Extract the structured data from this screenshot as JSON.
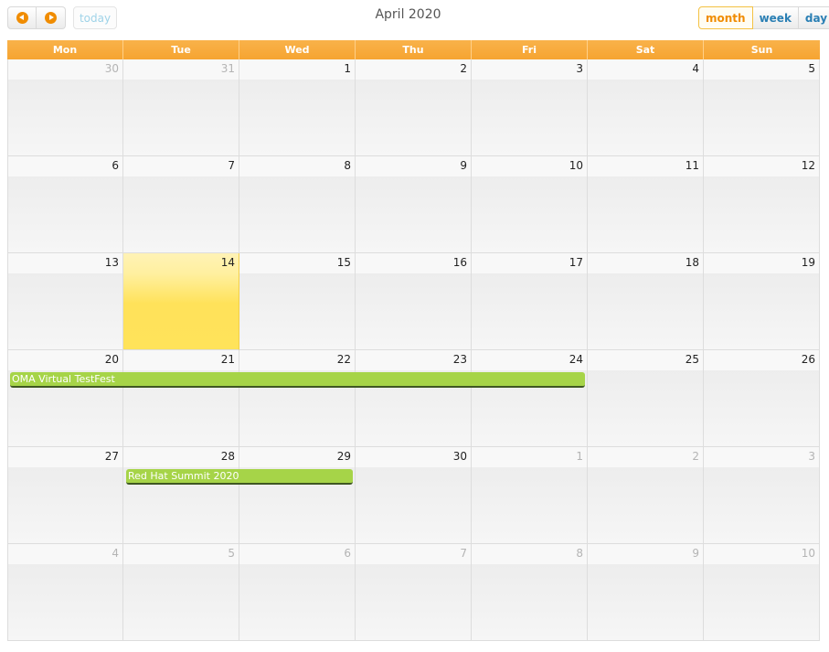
{
  "toolbar": {
    "prev_icon": "chevron-left-circle-icon",
    "next_icon": "chevron-right-circle-icon",
    "today_label": "today",
    "title": "April 2020",
    "views": [
      "month",
      "week",
      "day"
    ],
    "active_view": "month"
  },
  "calendar": {
    "day_headers": [
      "Mon",
      "Tue",
      "Wed",
      "Thu",
      "Fri",
      "Sat",
      "Sun"
    ],
    "weeks": [
      [
        "30",
        "31",
        "1",
        "2",
        "3",
        "4",
        "5"
      ],
      [
        "6",
        "7",
        "8",
        "9",
        "10",
        "11",
        "12"
      ],
      [
        "13",
        "14",
        "15",
        "16",
        "17",
        "18",
        "19"
      ],
      [
        "20",
        "21",
        "22",
        "23",
        "24",
        "25",
        "26"
      ],
      [
        "27",
        "28",
        "29",
        "30",
        "1",
        "2",
        "3"
      ],
      [
        "4",
        "5",
        "6",
        "7",
        "8",
        "9",
        "10"
      ]
    ],
    "other_month": [
      [
        true,
        true,
        false,
        false,
        false,
        false,
        false
      ],
      [
        false,
        false,
        false,
        false,
        false,
        false,
        false
      ],
      [
        false,
        false,
        false,
        false,
        false,
        false,
        false
      ],
      [
        false,
        false,
        false,
        false,
        false,
        false,
        false
      ],
      [
        false,
        false,
        false,
        false,
        true,
        true,
        true
      ],
      [
        true,
        true,
        true,
        true,
        true,
        true,
        true
      ]
    ],
    "today": "14"
  },
  "events": [
    {
      "title": "OMA Virtual TestFest",
      "start": "2020-04-20",
      "end": "2020-04-24"
    },
    {
      "title": "Red Hat Summit 2020",
      "start": "2020-04-28",
      "end": "2020-04-29"
    }
  ],
  "colors": {
    "header_orange": "#f6a431",
    "today_yellow": "#ffe35a",
    "event_green": "#a6d448",
    "nav_icon_orange": "#f08c00",
    "view_link_blue": "#2a7fb4"
  }
}
